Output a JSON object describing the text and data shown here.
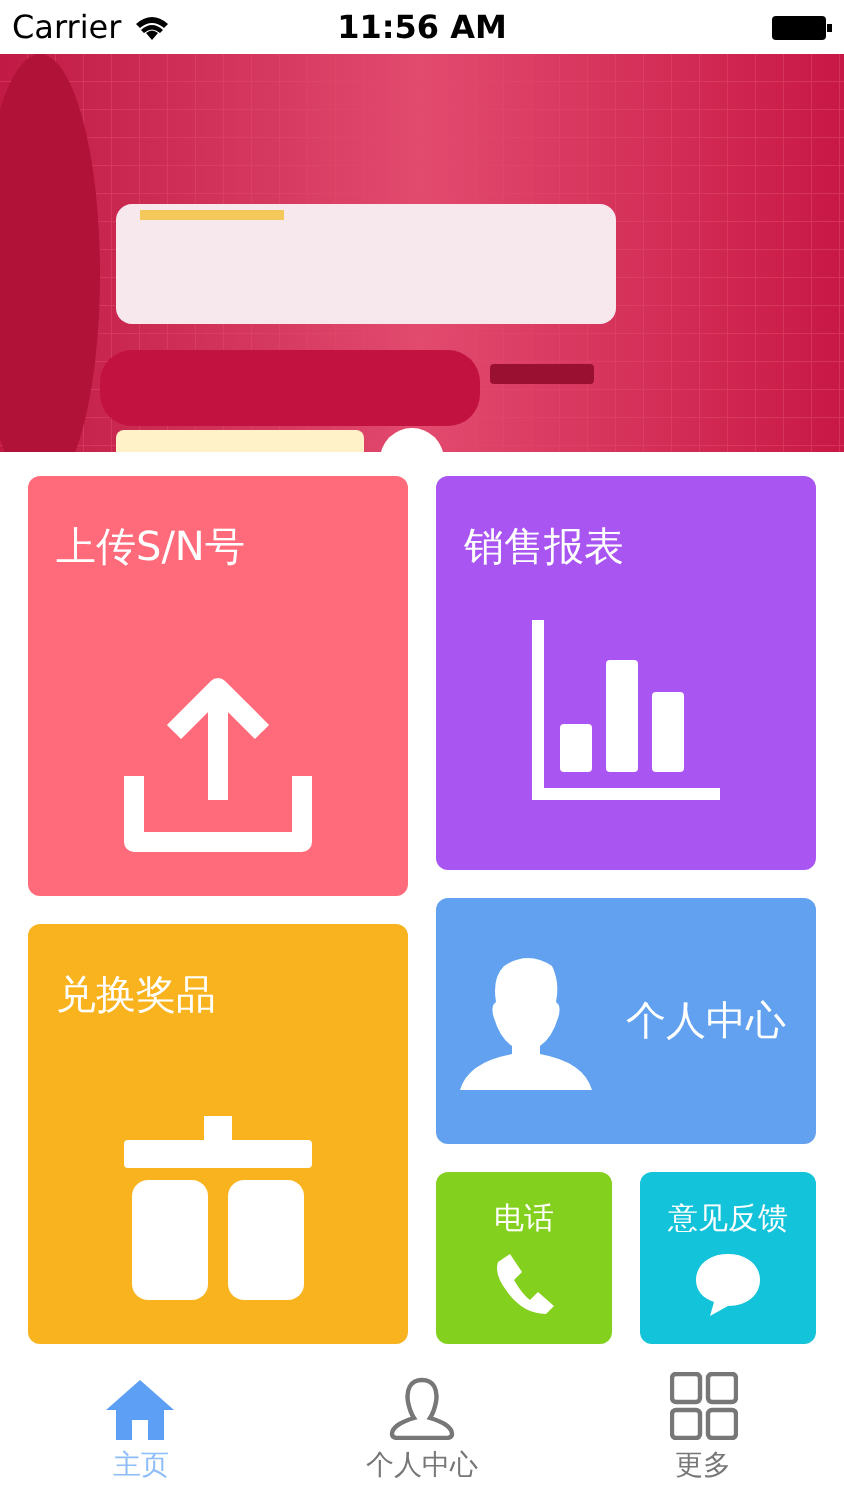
{
  "status_bar": {
    "carrier": "Carrier",
    "time": "11:56 AM"
  },
  "tiles": [
    {
      "kind": "upload",
      "label": "上传S/N号",
      "color": "#ff6b7b"
    },
    {
      "kind": "chart",
      "label": "销售报表",
      "color": "#a955f1"
    },
    {
      "kind": "gift",
      "label": "兑换奖品",
      "color": "#f8b31f"
    },
    {
      "kind": "profile",
      "label": "个人中心",
      "color": "#62a1ef"
    },
    {
      "kind": "phone",
      "label": "电话",
      "color": "#84d01e"
    },
    {
      "kind": "feedback",
      "label": "意见反馈",
      "color": "#12c3da"
    }
  ],
  "tabs": [
    {
      "kind": "home",
      "label": "主页",
      "selected": true
    },
    {
      "kind": "person",
      "label": "个人中心",
      "selected": false
    },
    {
      "kind": "grid",
      "label": "更多",
      "selected": false
    }
  ]
}
